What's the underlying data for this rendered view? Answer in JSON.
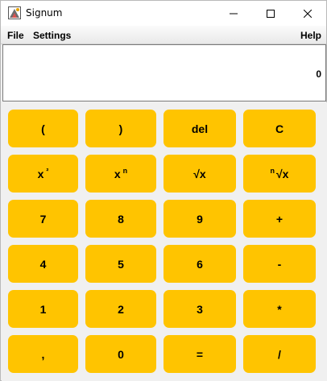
{
  "window": {
    "title": "Signum",
    "icon": "app-logo-icon",
    "controls": [
      "minimize-icon",
      "maximize-icon",
      "close-icon"
    ]
  },
  "menu": {
    "file": "File",
    "settings": "Settings",
    "help": "Help"
  },
  "display": {
    "value": "0"
  },
  "keys": {
    "open_paren": "(",
    "close_paren": ")",
    "del": "del",
    "clear": "C",
    "square_base": "x",
    "square_exp": "²",
    "power_base": "x",
    "power_exp": "n",
    "sqrt": "√x",
    "nroot_index": "n",
    "nroot_body": "√x",
    "seven": "7",
    "eight": "8",
    "nine": "9",
    "plus": "+",
    "four": "4",
    "five": "5",
    "six": "6",
    "minus": "-",
    "one": "1",
    "two": "2",
    "three": "3",
    "multiply": "*",
    "comma": ",",
    "zero": "0",
    "equals": "=",
    "divide": "/"
  },
  "colors": {
    "key_background": "#ffc400",
    "window_background": "#f0f0f0",
    "display_background": "#ffffff"
  }
}
